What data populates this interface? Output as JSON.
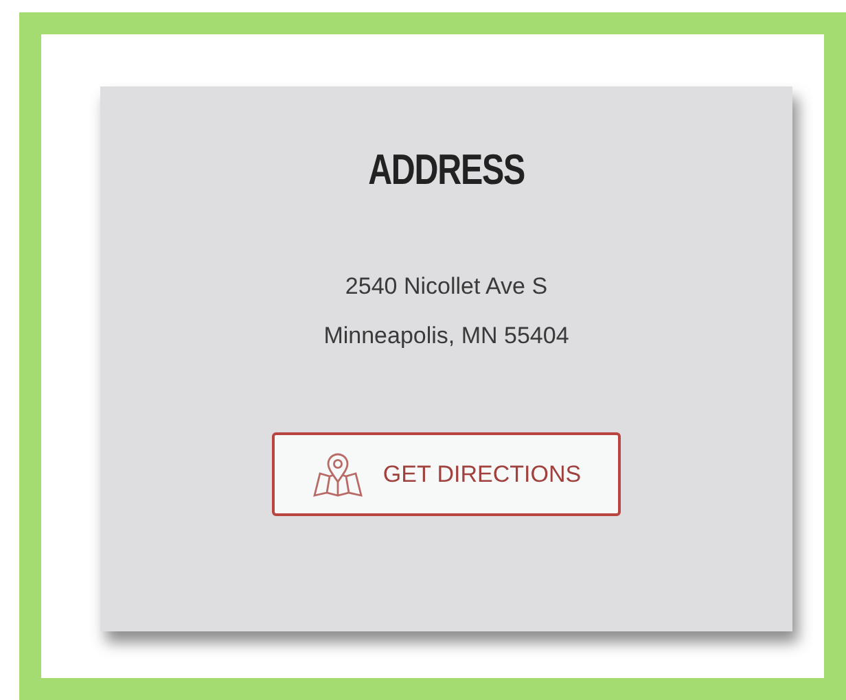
{
  "card": {
    "title": "ADDRESS",
    "address_lines": [
      "2540 Nicollet Ave S",
      "Minneapolis, MN 55404"
    ],
    "button": {
      "label": "GET DIRECTIONS"
    }
  }
}
